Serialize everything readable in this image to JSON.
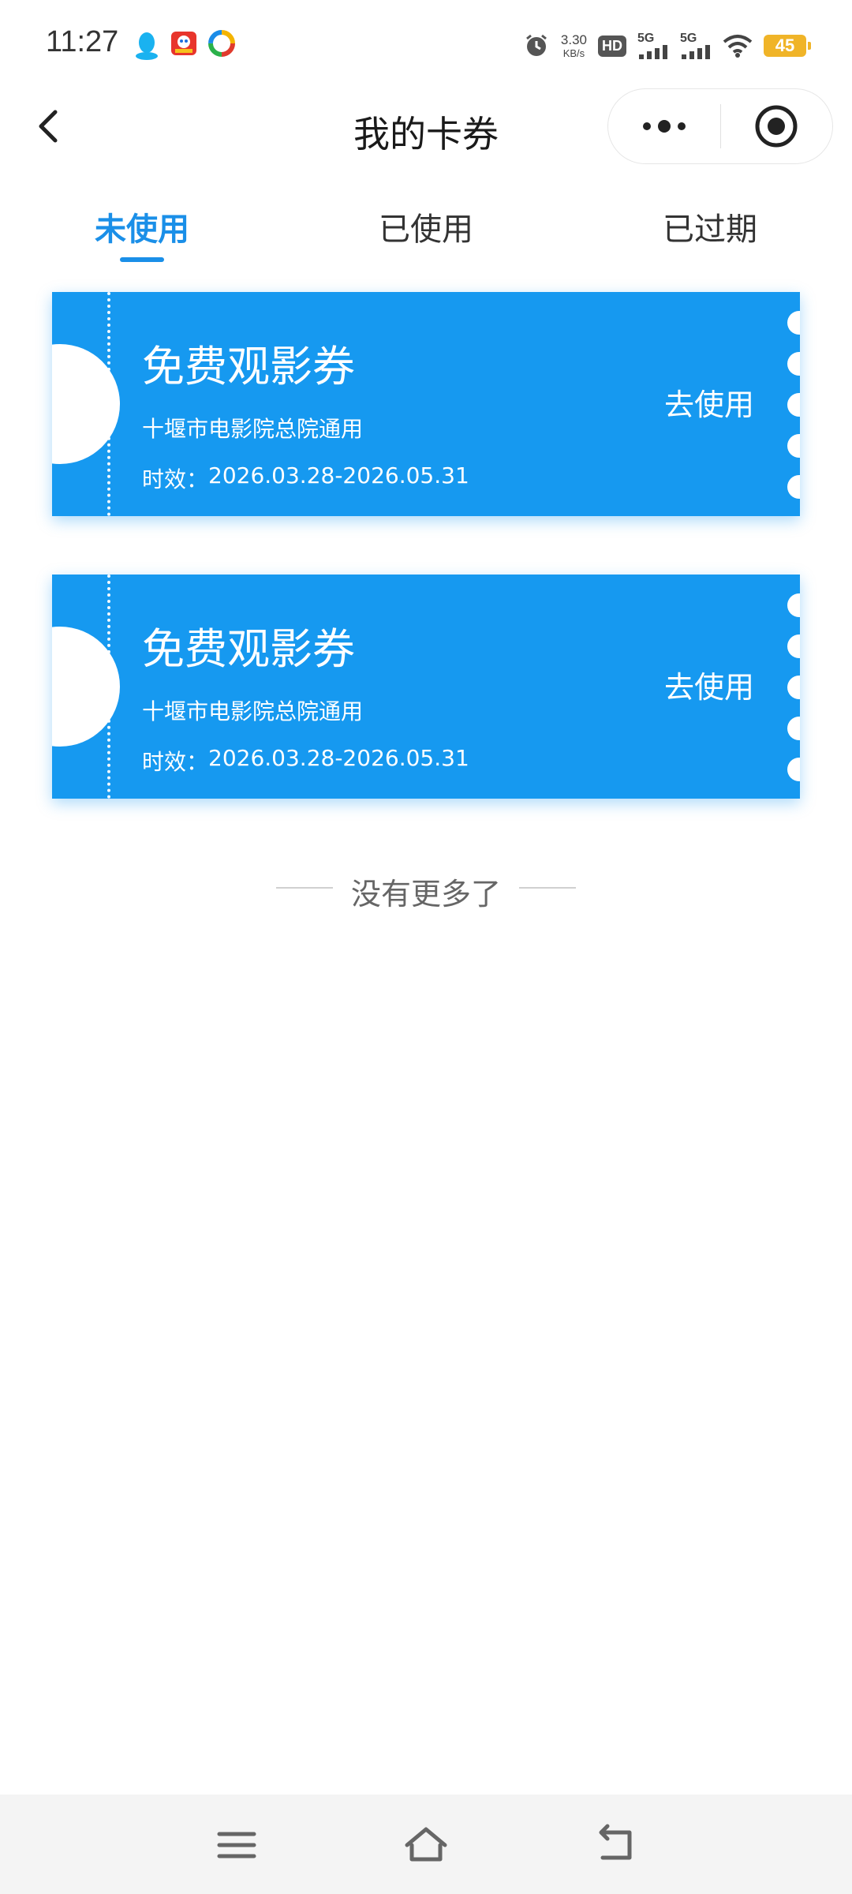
{
  "status_bar": {
    "time": "11:27",
    "net_speed_value": "3.30",
    "net_speed_unit": "KB/s",
    "hd_label": "HD",
    "sim1_label": "5G",
    "sim2_label": "5G",
    "battery": "45",
    "app_icons": [
      "qq-icon",
      "game-app-icon",
      "colorful-app-icon"
    ]
  },
  "header": {
    "title": "我的卡券"
  },
  "tabs": [
    {
      "label": "未使用",
      "active": true
    },
    {
      "label": "已使用",
      "active": false
    },
    {
      "label": "已过期",
      "active": false
    }
  ],
  "coupons": [
    {
      "title": "免费观影券",
      "scope": "十堰市电影院总院通用",
      "validity_label": "时效：",
      "validity_range": "2026.03.28-2026.05.31",
      "action": "去使用"
    },
    {
      "title": "免费观影券",
      "scope": "十堰市电影院总院通用",
      "validity_label": "时效：",
      "validity_range": "2026.03.28-2026.05.31",
      "action": "去使用"
    }
  ],
  "list_end": "没有更多了",
  "colors": {
    "accent": "#1a8fe8",
    "coupon_bg": "#1699f0"
  }
}
